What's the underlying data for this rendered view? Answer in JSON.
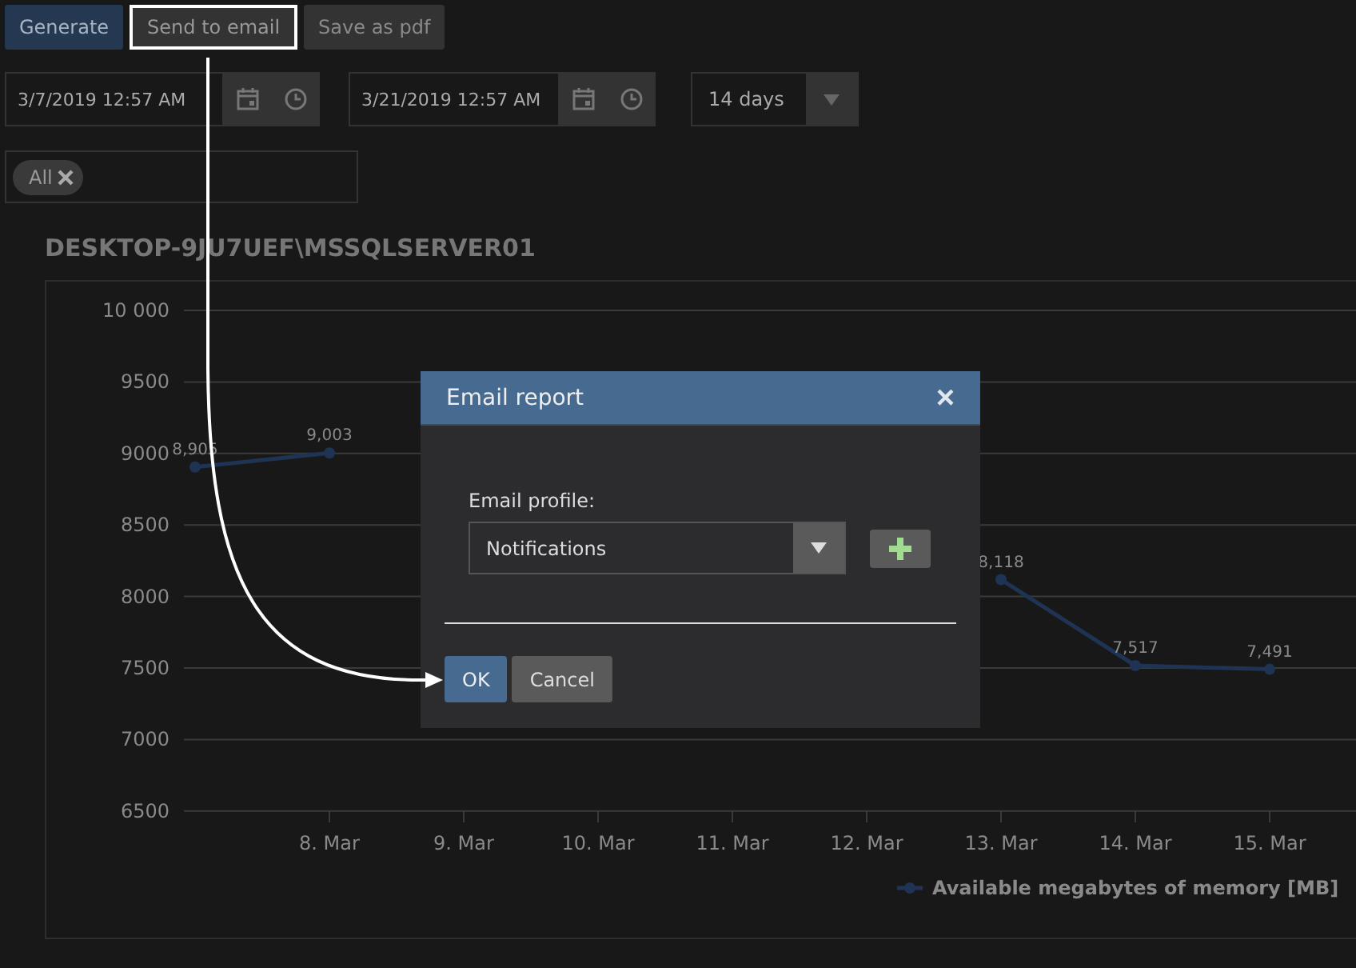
{
  "toolbar": {
    "buttons": [
      {
        "label": "Generate",
        "kind": "primary",
        "highlighted": false
      },
      {
        "label": "Send to email",
        "kind": "secondary",
        "highlighted": true
      },
      {
        "label": "Save as pdf",
        "kind": "secondary",
        "highlighted": false
      }
    ]
  },
  "range": {
    "from": "3/7/2019 12:57 AM",
    "to": "3/21/2019 12:57 AM",
    "period": "14 days"
  },
  "filter": {
    "tags": [
      {
        "label": "All"
      }
    ]
  },
  "report_title": "DESKTOP-9JU7UEF\\MSSQLSERVER01",
  "chart": {
    "chart_data": {
      "type": "line",
      "categories": [
        null,
        "8. Mar",
        "9. Mar",
        "10. Mar",
        "11. Mar",
        "12. Mar",
        "13. Mar",
        "14. Mar",
        "15. Mar"
      ],
      "ylim": [
        6500,
        10000
      ],
      "yticks": [
        6500,
        7000,
        7500,
        8000,
        8500,
        9000,
        9500,
        {
          "value": 10000,
          "label": "10 000"
        }
      ],
      "grid": true,
      "value_labels": [
        "8,905",
        "9,003",
        null,
        null,
        null,
        null,
        "8,118",
        "7,517",
        "7,491"
      ],
      "series": [
        {
          "name": "Available megabytes of memory [MB]",
          "color": "#1f3454",
          "marker": true,
          "values": [
            8905,
            9003,
            null,
            null,
            null,
            null,
            8118,
            7517,
            7491
          ]
        }
      ]
    }
  },
  "dialog": {
    "title": "Email report",
    "close": "×",
    "field_label": "Email profile:",
    "profile": "Notifications",
    "buttons": [
      {
        "label": "OK",
        "kind": "primary"
      },
      {
        "label": "Cancel",
        "kind": "secondary"
      }
    ]
  }
}
